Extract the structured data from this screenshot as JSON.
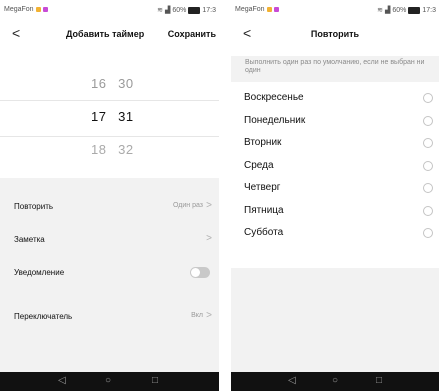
{
  "left": {
    "status": {
      "carrier": "MegaFon",
      "signal": "60%",
      "time": "17:3"
    },
    "header": {
      "back": "<",
      "title": "Добавить таймер",
      "save": "Сохранить"
    },
    "picker": {
      "rows": [
        {
          "hour": "16",
          "minute": "30"
        },
        {
          "hour": "17",
          "minute": "31"
        },
        {
          "hour": "18",
          "minute": "32"
        }
      ]
    },
    "settings": {
      "repeat": {
        "label": "Повторить",
        "value": "Один раз",
        "chevron": ">"
      },
      "note": {
        "label": "Заметка",
        "chevron": ">"
      },
      "notification": {
        "label": "Уведомление",
        "toggle_on": false
      },
      "switch": {
        "label": "Переключатель",
        "value": "Вкл",
        "chevron": ">"
      }
    }
  },
  "right": {
    "status": {
      "carrier": "MegaFon",
      "signal": "60%",
      "time": "17:3"
    },
    "header": {
      "back": "<",
      "title": "Повторить"
    },
    "hint": "Выполнить один раз по умолчанию, если не выбран ни один",
    "days": [
      "Воскресенье",
      "Понедельник",
      "Вторник",
      "Среда",
      "Четверг",
      "Пятница",
      "Суббота"
    ]
  },
  "navbar": {
    "back": "◁",
    "home": "○",
    "recent": "□"
  },
  "colors": {
    "carrier_badge_1": "#f2b233",
    "carrier_badge_2": "#c84bd6",
    "toggle_off": "#c9c9c9"
  }
}
